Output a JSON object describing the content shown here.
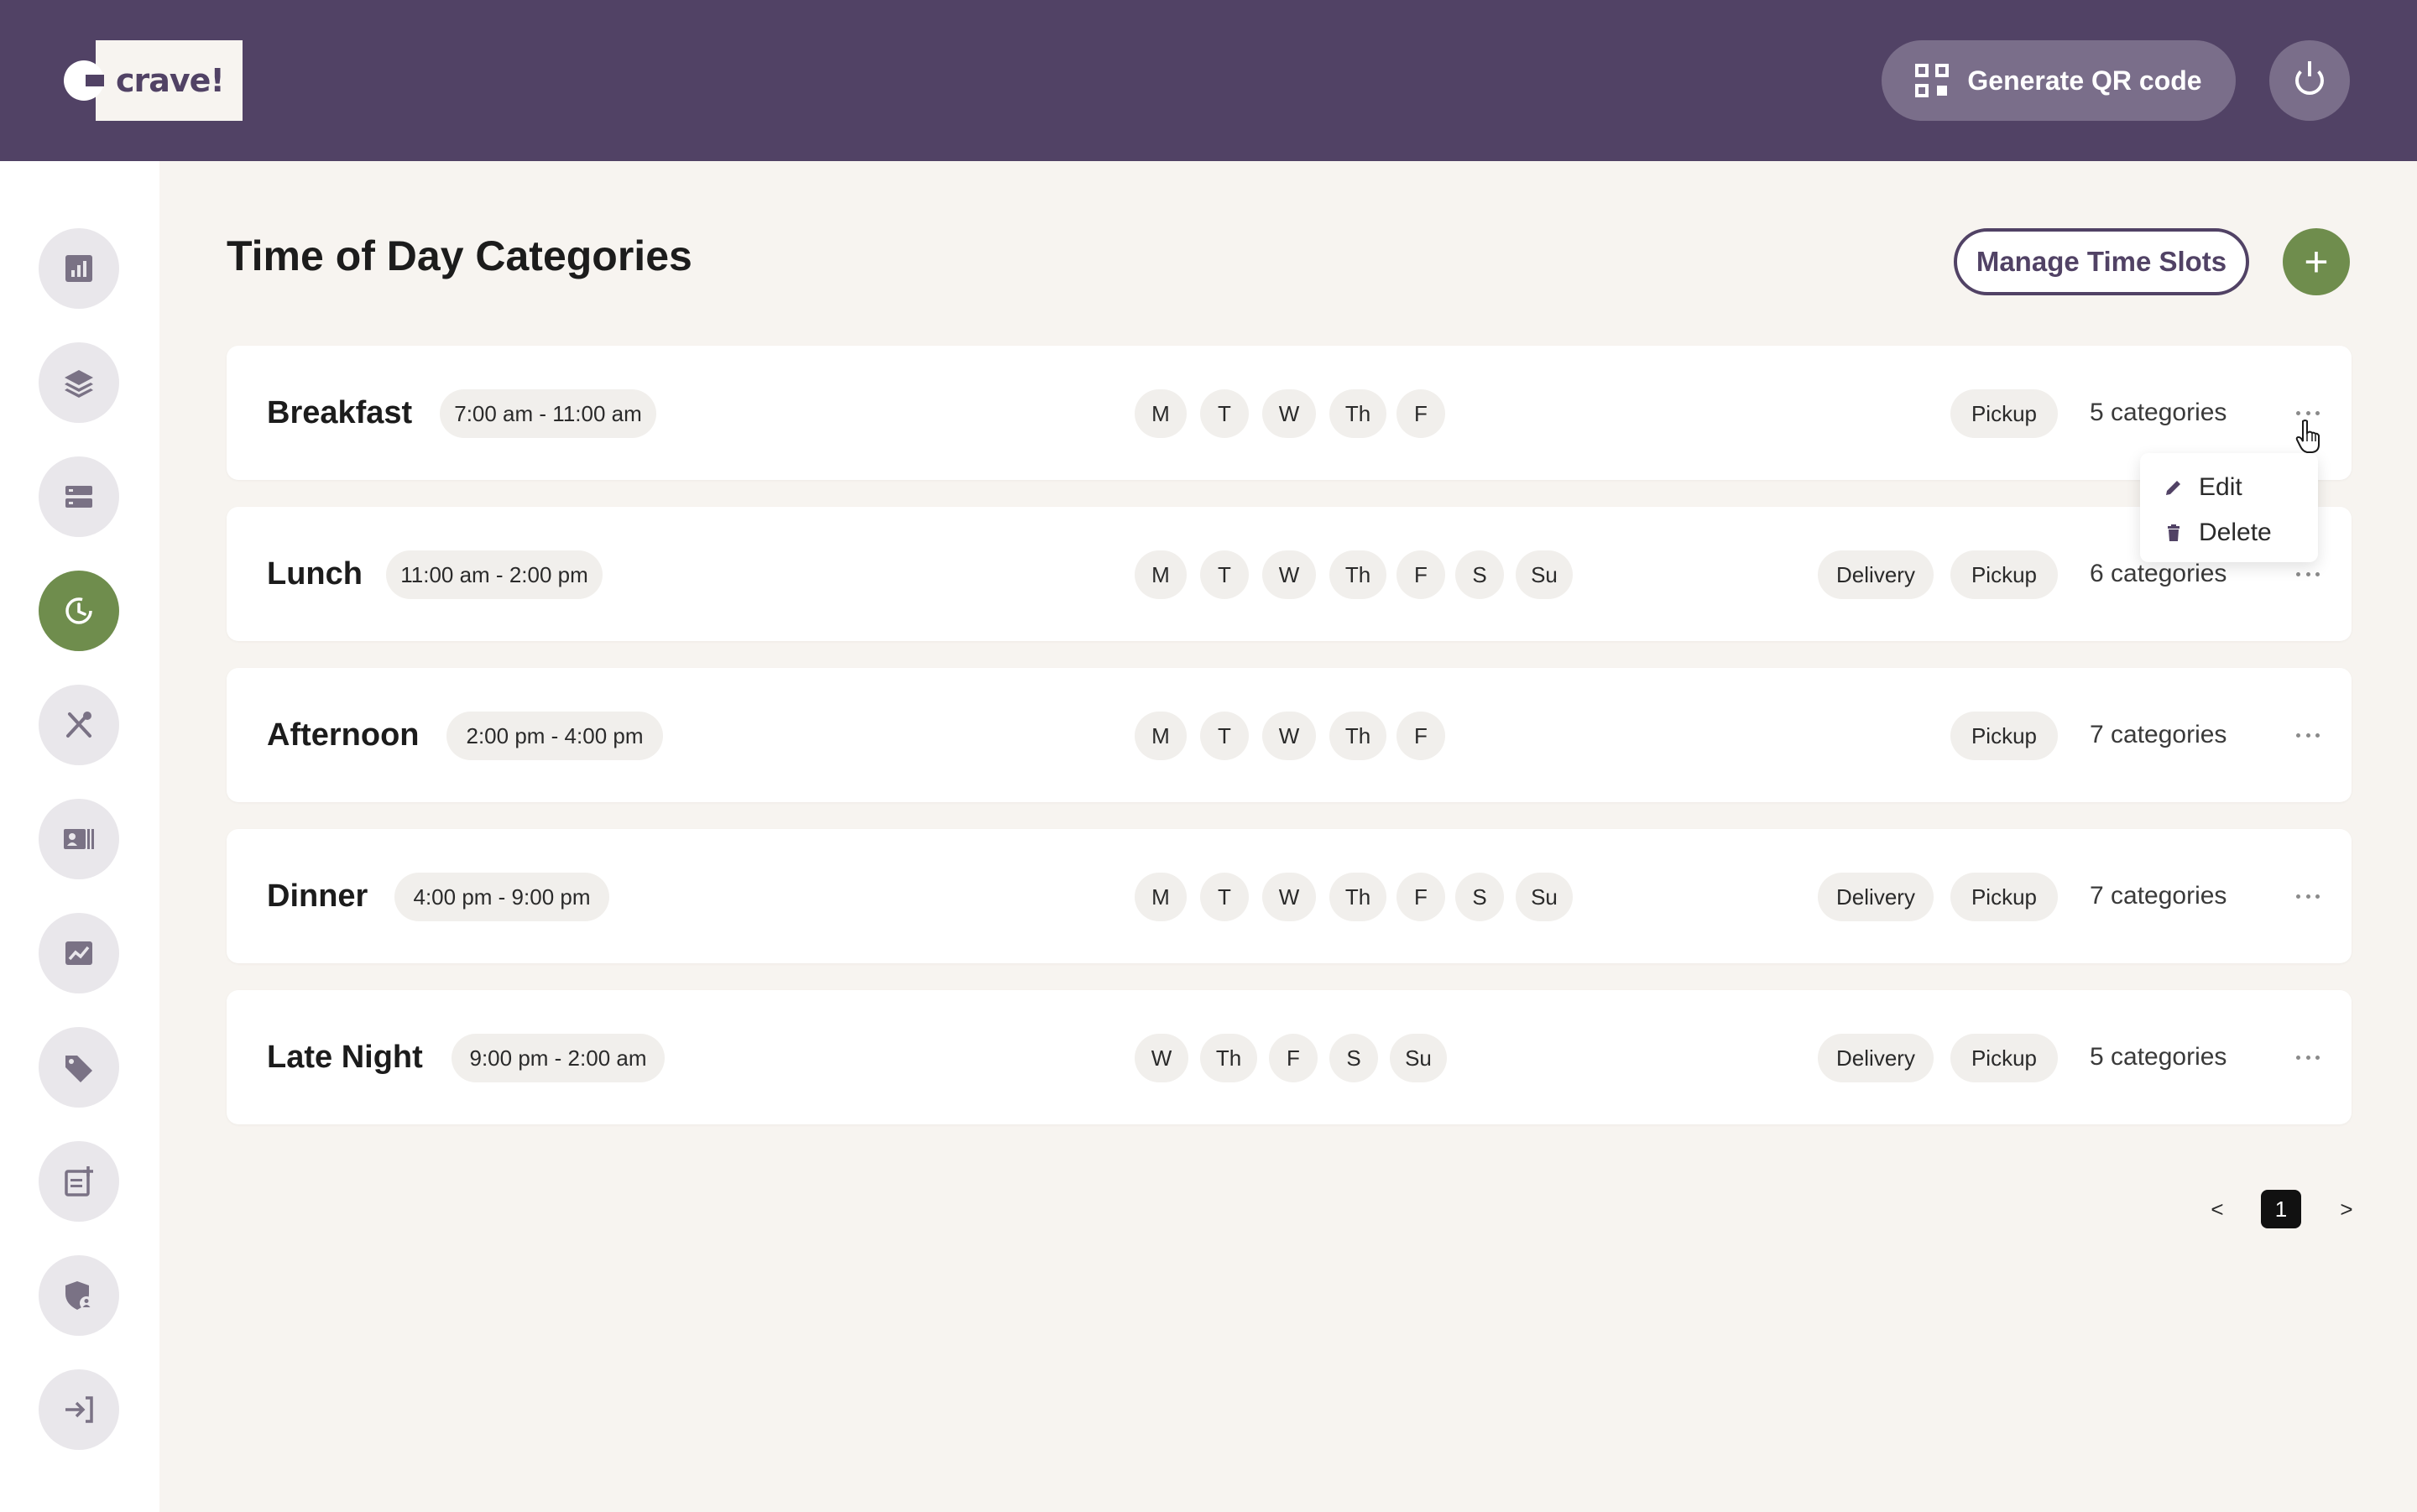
{
  "brand": {
    "logo_text": "crave!"
  },
  "header": {
    "qr_button_label": "Generate QR code"
  },
  "page": {
    "title": "Time of Day Categories",
    "manage_button_label": "Manage Time Slots",
    "add_button_label": "+"
  },
  "sidebar": {
    "items": [
      {
        "name": "dashboard",
        "icon": "bar-chart-icon",
        "active": false
      },
      {
        "name": "layers",
        "icon": "layers-icon",
        "active": false
      },
      {
        "name": "servers",
        "icon": "server-icon",
        "active": false
      },
      {
        "name": "time-of-day",
        "icon": "clock-icon",
        "active": true
      },
      {
        "name": "menu",
        "icon": "utensils-icon",
        "active": false
      },
      {
        "name": "contacts",
        "icon": "contact-card-icon",
        "active": false
      },
      {
        "name": "analytics",
        "icon": "trend-chart-icon",
        "active": false
      },
      {
        "name": "promotions",
        "icon": "price-tag-icon",
        "active": false
      },
      {
        "name": "reports",
        "icon": "document-add-icon",
        "active": false
      },
      {
        "name": "security",
        "icon": "shield-user-icon",
        "active": false
      },
      {
        "name": "sign-in",
        "icon": "sign-in-icon",
        "active": false
      }
    ]
  },
  "slots": [
    {
      "name": "Breakfast",
      "time": "7:00 am - 11:00 am",
      "days": [
        "M",
        "T",
        "W",
        "Th",
        "F"
      ],
      "services": [
        "Pickup"
      ],
      "categories": "5 categories"
    },
    {
      "name": "Lunch",
      "time": "11:00 am - 2:00 pm",
      "days": [
        "M",
        "T",
        "W",
        "Th",
        "F",
        "S",
        "Su"
      ],
      "services": [
        "Delivery",
        "Pickup"
      ],
      "categories": "6 categories"
    },
    {
      "name": "Afternoon",
      "time": "2:00 pm - 4:00 pm",
      "days": [
        "M",
        "T",
        "W",
        "Th",
        "F"
      ],
      "services": [
        "Pickup"
      ],
      "categories": "7 categories"
    },
    {
      "name": "Dinner",
      "time": "4:00 pm - 9:00 pm",
      "days": [
        "M",
        "T",
        "W",
        "Th",
        "F",
        "S",
        "Su"
      ],
      "services": [
        "Delivery",
        "Pickup"
      ],
      "categories": "7 categories"
    },
    {
      "name": "Late Night",
      "time": "9:00 pm - 2:00 am",
      "days": [
        "W",
        "Th",
        "F",
        "S",
        "Su"
      ],
      "services": [
        "Delivery",
        "Pickup"
      ],
      "categories": "5 categories"
    }
  ],
  "context_menu": {
    "edit_label": "Edit",
    "delete_label": "Delete"
  },
  "pagination": {
    "prev": "<",
    "current": "1",
    "next": ">"
  },
  "colors": {
    "header": "#514265",
    "accent_green": "#6f8d4d",
    "background": "#f7f4f0"
  }
}
